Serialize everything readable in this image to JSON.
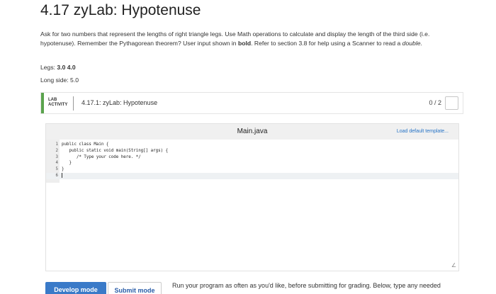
{
  "page": {
    "title": "4.17 zyLab: Hypotenuse"
  },
  "instructions": {
    "part1": "Ask for two numbers that represent the lengths of right triangle legs. Use Math operations to calculate and display the length of the third side (i.e. hypotenuse). Remember the Pythagorean theorem? User input shown in ",
    "bold_word": "bold",
    "part2": ". Refer to section 3.8 for help using a Scanner to read a ",
    "italic_word": "double",
    "part3": "."
  },
  "example_io": {
    "legs_label": "Legs: ",
    "legs_value": "3.0 4.0",
    "long_side": "Long side: 5.0"
  },
  "activity": {
    "lab_label_1": "LAB",
    "lab_label_2": "ACTIVITY",
    "title": "4.17.1: zyLab: Hypotenuse",
    "score": "0 / 2"
  },
  "editor": {
    "file_name": "Main.java",
    "load_default_label": "Load default template...",
    "lines": [
      {
        "num": "1",
        "code": "public class Main {"
      },
      {
        "num": "2",
        "code": "   public static void main(String[] args) {"
      },
      {
        "num": "3",
        "code": "      /* Type your code here. */"
      },
      {
        "num": "4",
        "code": "   }"
      },
      {
        "num": "5",
        "code": "}"
      },
      {
        "num": "6",
        "code": ""
      }
    ]
  },
  "modes": {
    "develop_label": "Develop mode",
    "submit_label": "Submit mode",
    "run_text": "Run your program as often as you'd like, before submitting for grading. Below, type any needed"
  }
}
